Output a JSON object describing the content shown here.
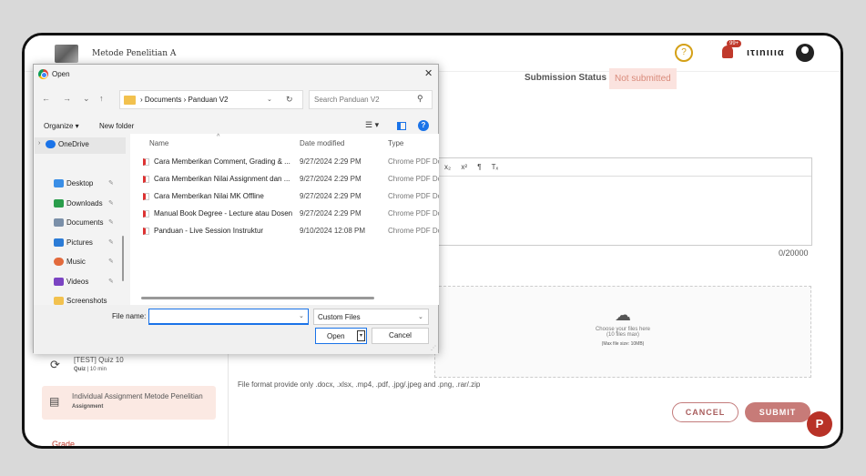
{
  "app": {
    "course_title": "Metode Penelitian A",
    "username": "ιτιnιιια",
    "notification_badge": "99+",
    "submission_status_label": "Submission Status",
    "submission_status_value": "Not submitted",
    "editor_toolbar": [
      "x₂",
      "x²",
      "¶",
      "Tₓ"
    ],
    "char_count": "0/20000",
    "upload": {
      "line1": "Choose your files here",
      "line2": "(10 files max)",
      "line3": "(Max file size: 10MB)"
    },
    "format_note": "File format provide only .docx, .xlsx, .mp4, .pdf, .jpg/.jpeg and .png, .rar/.zip",
    "cancel_label": "CANCEL",
    "submit_label": "SUBMIT",
    "help_fab": "P",
    "sidebar": {
      "quiz_title": "[TEST] Quiz 10",
      "quiz_meta_type": "Quiz",
      "quiz_meta_duration": "10 min",
      "assign_title": "Individual Assignment Metode Penelitian",
      "assign_meta": "Assignment",
      "grade_label": "Grade"
    }
  },
  "dialog": {
    "title": "Open",
    "close": "✕",
    "address_path": "› Documents › Panduan V2",
    "search_placeholder": "Search Panduan V2",
    "organize_label": "Organize ▾",
    "new_folder_label": "New folder",
    "nav_items": [
      {
        "label": "OneDrive",
        "color": "#1a73e8"
      },
      {
        "label": "Desktop",
        "color": "#3a8ee6"
      },
      {
        "label": "Downloads",
        "color": "#2a9d4b"
      },
      {
        "label": "Documents",
        "color": "#7a8fa8"
      },
      {
        "label": "Pictures",
        "color": "#2b7bd6"
      },
      {
        "label": "Music",
        "color": "#e26a3c"
      },
      {
        "label": "Videos",
        "color": "#7b44c2"
      },
      {
        "label": "Screenshots",
        "color": "#f2c14e"
      }
    ],
    "columns": {
      "name": "Name",
      "date": "Date modified",
      "type": "Type"
    },
    "files": [
      {
        "name": "Cara Memberikan Comment, Grading & ...",
        "date": "9/27/2024 2:29 PM",
        "type": "Chrome PDF Do"
      },
      {
        "name": "Cara Memberikan Nilai Assignment dan ...",
        "date": "9/27/2024 2:29 PM",
        "type": "Chrome PDF Do"
      },
      {
        "name": "Cara Memberikan Nilai MK Offline",
        "date": "9/27/2024 2:29 PM",
        "type": "Chrome PDF Do"
      },
      {
        "name": "Manual Book Degree - Lecture atau Dosen",
        "date": "9/27/2024 2:29 PM",
        "type": "Chrome PDF Do"
      },
      {
        "name": "Panduan - Live Session Instruktur",
        "date": "9/10/2024 12:08 PM",
        "type": "Chrome PDF Do"
      }
    ],
    "file_name_label": "File name:",
    "file_name_value": "",
    "filter_value": "Custom Files",
    "open_label": "Open",
    "cancel_label": "Cancel"
  }
}
